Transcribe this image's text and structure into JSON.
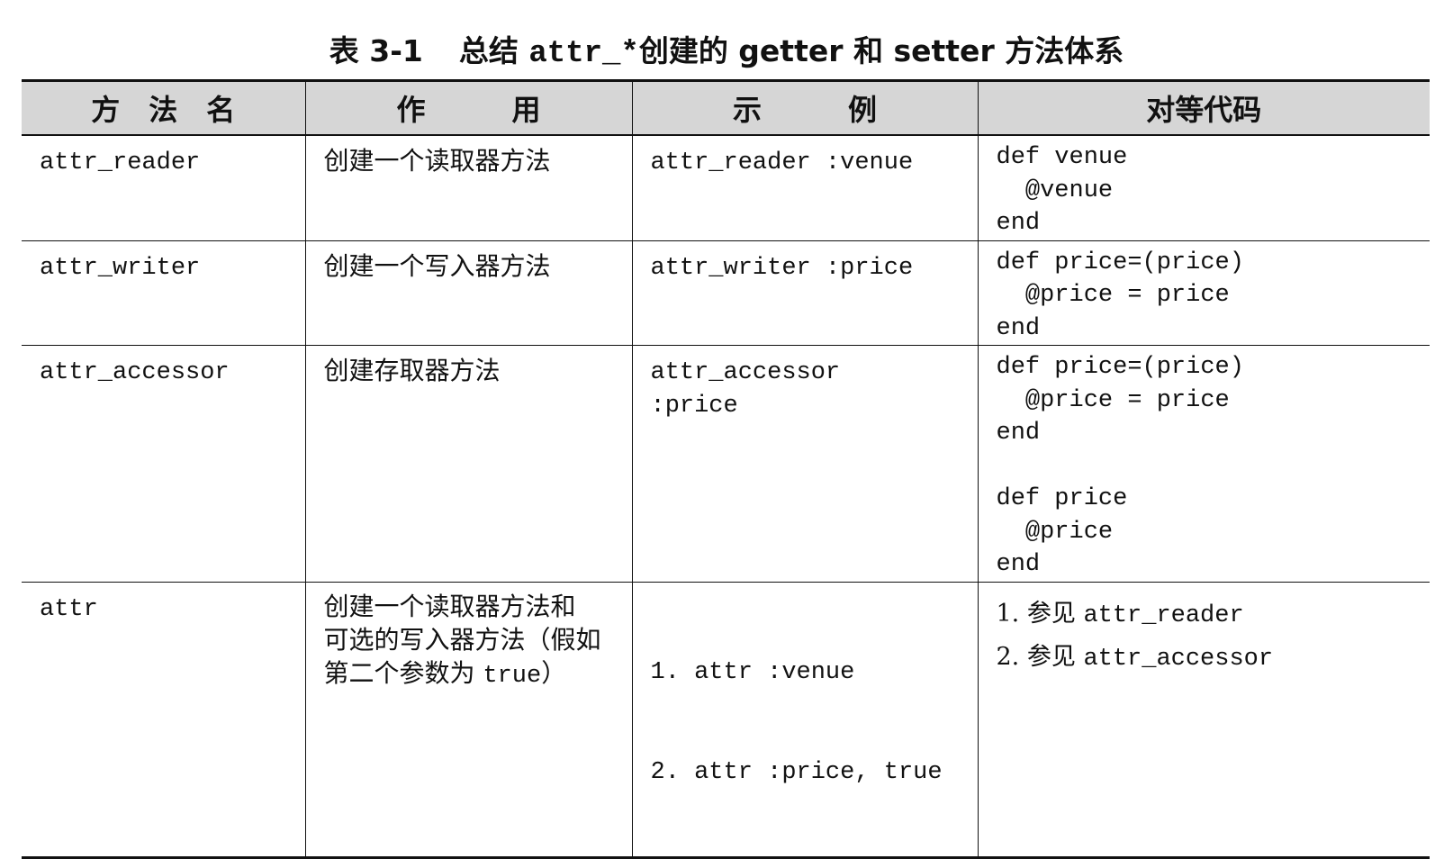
{
  "caption": {
    "prefix": "表 3-1",
    "text_before": "总结 ",
    "code": "attr_*",
    "text_after": "创建的 getter 和 setter 方法体系"
  },
  "table": {
    "headers": [
      "方　法　名",
      "作　　　用",
      "示　　　例",
      "对等代码"
    ],
    "rows": [
      {
        "name": "attr_reader",
        "desc": "创建一个读取器方法",
        "example": "attr_reader :venue",
        "code": "def venue\n  @venue\nend"
      },
      {
        "name": "attr_writer",
        "desc": "创建一个写入器方法",
        "example": "attr_writer :price",
        "code": "def price=(price)\n  @price = price\nend"
      },
      {
        "name": "attr_accessor",
        "desc": "创建存取器方法",
        "example": "attr_accessor\n:price",
        "code": "def price=(price)\n  @price = price\nend\n\ndef price\n  @price\nend"
      },
      {
        "name": "attr",
        "desc_line1": "创建一个读取器方法和",
        "desc_line2": "可选的写入器方法（假如",
        "desc_line3_pre": "第二个参数为 ",
        "desc_line3_code": "true",
        "desc_line3_post": "）",
        "example_1_num": "1.",
        "example_1": " attr :venue",
        "example_2_num": "2.",
        "example_2": " attr :price, true",
        "ref_1_num": "1.",
        "ref_1_text": " 参见 ",
        "ref_1_code": "attr_reader",
        "ref_2_num": "2.",
        "ref_2_text": " 参见 ",
        "ref_2_code": "attr_accessor"
      }
    ]
  }
}
